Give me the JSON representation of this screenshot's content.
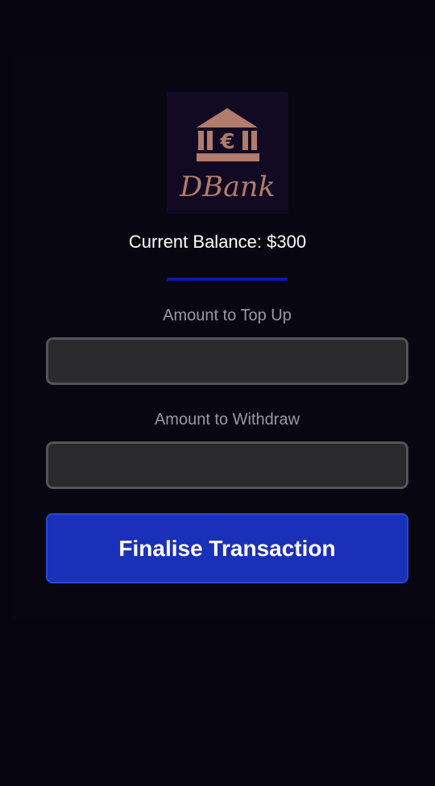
{
  "logo": {
    "text": "DBank",
    "icon_symbol": "€",
    "icon": "bank-building-icon",
    "color": "#b07c6b",
    "background": "#120a22"
  },
  "balance": {
    "label": "Current Balance: $300"
  },
  "topup": {
    "label": "Amount to Top Up",
    "value": "",
    "placeholder": ""
  },
  "withdraw": {
    "label": "Amount to Withdraw",
    "value": "",
    "placeholder": ""
  },
  "finalise_button": {
    "label": "Finalise Transaction",
    "color": "#1a30b8"
  },
  "colors": {
    "background": "#06050f",
    "divider": "#0d1aa0",
    "input_background": "#2a2a2c",
    "input_border": "#545458"
  }
}
